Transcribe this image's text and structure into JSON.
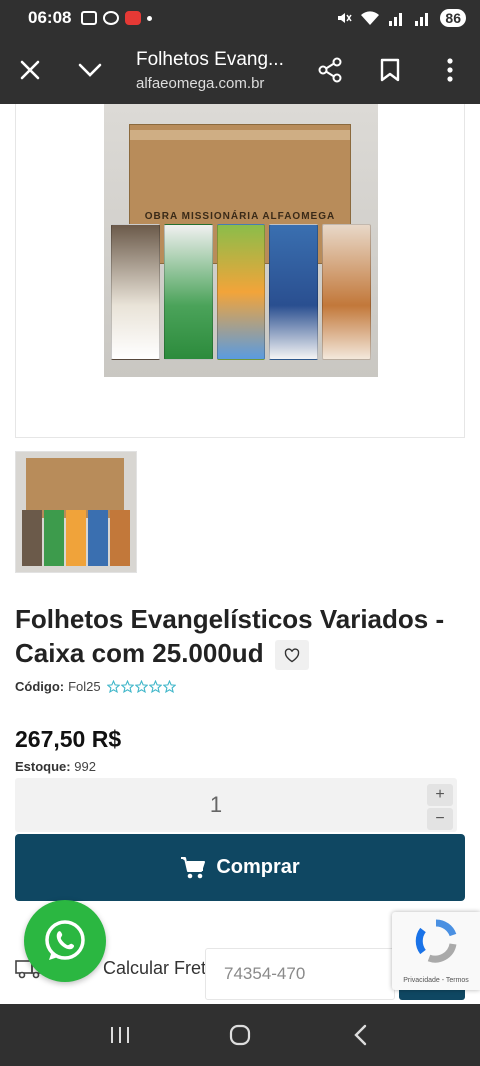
{
  "status_bar": {
    "time": "06:08",
    "battery": "86"
  },
  "browser": {
    "title": "Folhetos Evang...",
    "url": "alfaeomega.com.br"
  },
  "product": {
    "box_brand": "OBRA MISSIONÁRIA ALFAOMEGA",
    "title": "Folhetos Evangelísticos Variados - Caixa com 25.000ud",
    "code_label": "Código:",
    "code_value": "Fol25",
    "rating_stars": 5,
    "rating_value": 0,
    "price": "267,50 R$",
    "stock_label": "Estoque:",
    "stock_value": "992",
    "quantity": "1",
    "qty_plus": "+",
    "qty_minus": "−",
    "buy_label": "Comprar",
    "brand_color": "#0f4762"
  },
  "shipping": {
    "label": "Calcular Frete:",
    "cep_value": "74354-470"
  },
  "recaptcha": {
    "links": "Privacidade - Termos"
  },
  "floating": {
    "whatsapp_color": "#2bb741"
  }
}
